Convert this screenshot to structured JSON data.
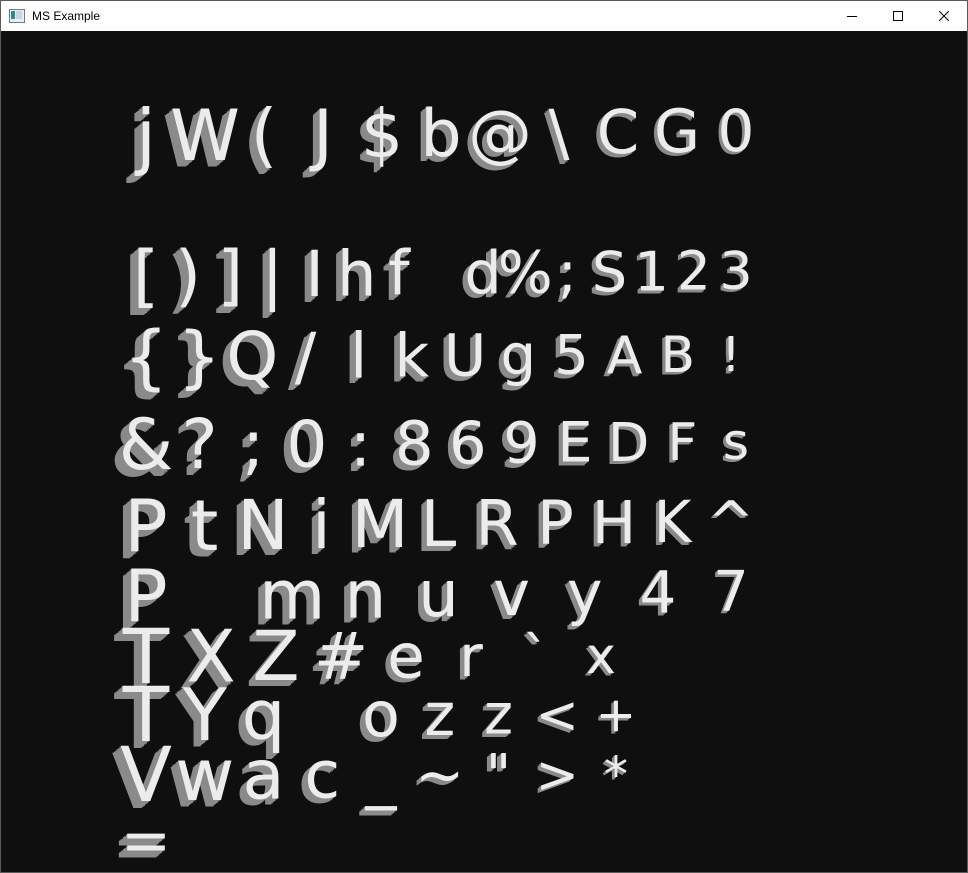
{
  "window": {
    "title": "MS Example",
    "icon": "app-window-icon",
    "controls": {
      "minimize": "minimize-icon",
      "maximize": "maximize-icon",
      "close": "close-icon"
    }
  },
  "scene": {
    "background": "#0f0f0f",
    "face_color": "#ececec",
    "side_color": "#8a8a8a",
    "rows": [
      "jW(J$b@\\CG0",
      "[)]|Ihf d%;S123",
      "{}Q/lkUg5AB!",
      "&?;0:869EDFs",
      "PtNiMLRPHK^",
      "P mnuvy47",
      "TXZ#er`x",
      "TYq ozz<+",
      "Vwac_~\">*",
      "="
    ]
  }
}
